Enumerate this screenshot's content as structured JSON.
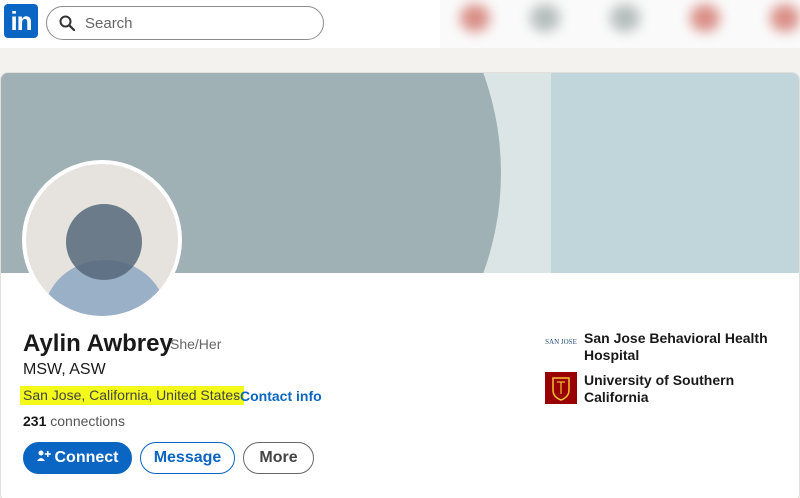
{
  "nav": {
    "logo": "in",
    "search_placeholder": "Search"
  },
  "profile": {
    "name": "Aylin Awbrey",
    "pronouns": "She/Her",
    "headline": "MSW, ASW",
    "location": "San Jose, California, United States",
    "separator": "·",
    "contact_info": "Contact info",
    "connections_count": "231",
    "connections_label": "connections"
  },
  "actions": {
    "connect": "Connect",
    "message": "Message",
    "more": "More"
  },
  "organizations": [
    {
      "name": "San Jose Behavioral Health Hospital",
      "logo_text": "SAN JOSE"
    },
    {
      "name": "University of Southern California"
    }
  ],
  "colors": {
    "brand": "#0a66c2",
    "highlight": "#f3f91a",
    "usc": "#990000"
  }
}
